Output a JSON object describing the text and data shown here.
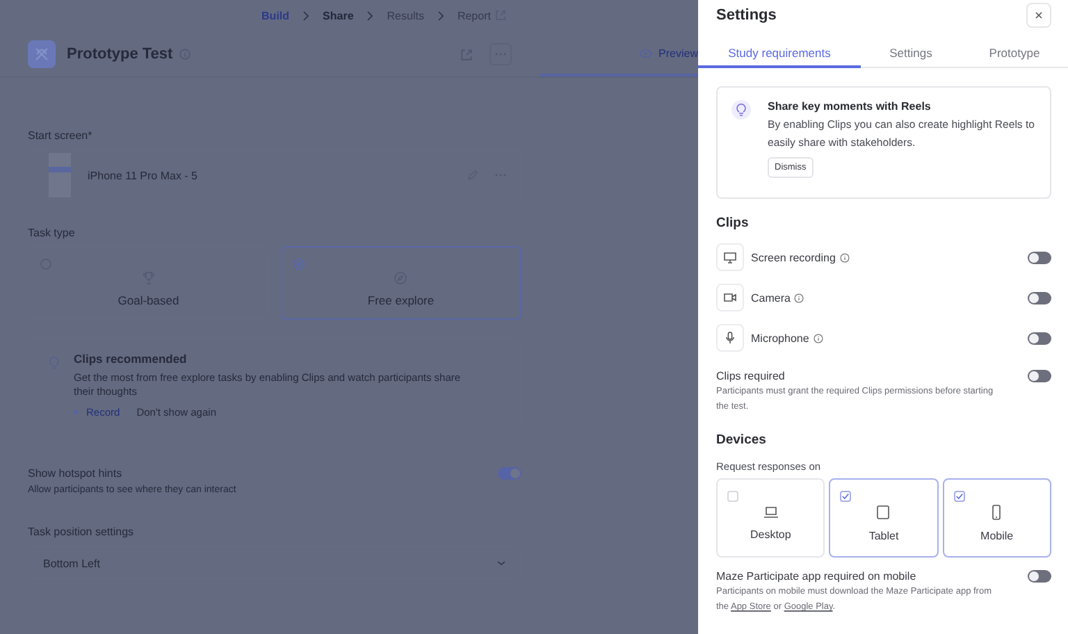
{
  "breadcrumb": [
    {
      "label": "Build",
      "selected": true,
      "disabled": false
    },
    {
      "label": "Share",
      "selected": false,
      "disabled": false
    },
    {
      "label": "Results",
      "selected": false,
      "disabled": true
    },
    {
      "label": "Report",
      "selected": false,
      "disabled": true
    }
  ],
  "study": {
    "title": "Prototype Test",
    "preview_tab": "Preview"
  },
  "start_screen": {
    "label": "Start screen*",
    "screen_name": "iPhone 11 Pro Max - 5"
  },
  "task_type": {
    "label": "Task type",
    "options": [
      {
        "kind": "goal",
        "label": "Goal-based",
        "selected": false
      },
      {
        "kind": "explore",
        "label": "Free explore",
        "selected": true
      }
    ]
  },
  "clips_hint": {
    "title": "Clips recommended",
    "body": "Get the most from free explore tasks by enabling Clips and watch participants share their thoughts",
    "action": "Record",
    "dismiss": "Don't show again"
  },
  "hotspot": {
    "label": "Show hotspot hints",
    "description": "Allow participants to see where they can interact",
    "on": true
  },
  "task_position": {
    "label": "Task position settings",
    "value": "Bottom Left"
  },
  "panel": {
    "title": "Settings",
    "tabs": [
      {
        "label": "Study requirements",
        "selected": true
      },
      {
        "label": "Settings",
        "selected": false
      },
      {
        "label": "Prototype",
        "selected": false
      }
    ],
    "reels_card": {
      "title": "Share key moments with Reels",
      "body": "By enabling Clips you can also create highlight Reels to easily share with stakeholders.",
      "dismiss": "Dismiss"
    },
    "clips": {
      "heading": "Clips",
      "sources": [
        {
          "kind": "screen",
          "label": "Screen recording",
          "on": false
        },
        {
          "kind": "camera",
          "label": "Camera",
          "on": false
        },
        {
          "kind": "microphone",
          "label": "Microphone",
          "on": false
        }
      ],
      "required": {
        "label": "Clips required",
        "description": "Participants must grant the required Clips permissions before starting the test.",
        "on": false
      }
    },
    "devices": {
      "heading": "Devices",
      "prompt": "Request responses on",
      "options": [
        {
          "kind": "desktop",
          "label": "Desktop",
          "checked": false,
          "selected": false
        },
        {
          "kind": "tablet",
          "label": "Tablet",
          "checked": true,
          "selected": true
        },
        {
          "kind": "mobile",
          "label": "Mobile",
          "checked": true,
          "selected": true
        }
      ],
      "app_required": {
        "label": "Maze Participate app required on mobile",
        "description_start": "Participants on mobile must download the Maze Participate app from the ",
        "app_store_link": "App Store",
        "description_middle": " or ",
        "google_play_link": "Google Play",
        "description_end": ".",
        "on": false
      }
    }
  }
}
